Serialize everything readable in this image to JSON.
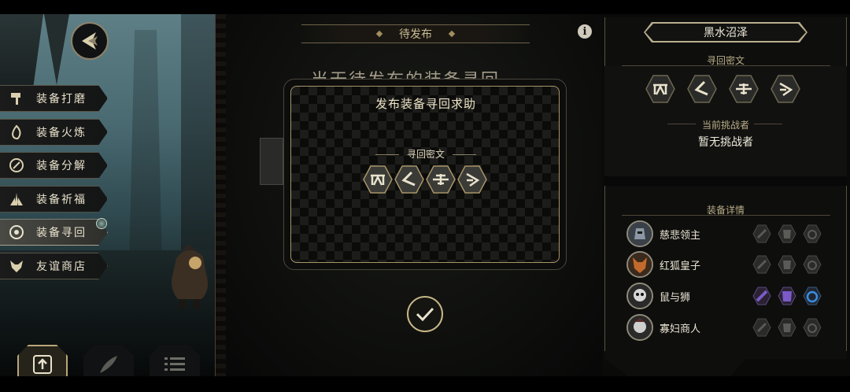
{
  "menu": {
    "items": [
      {
        "label": "装备打磨",
        "icon": "hammer-icon",
        "active": false
      },
      {
        "label": "装备火炼",
        "icon": "flame-icon",
        "active": false
      },
      {
        "label": "装备分解",
        "icon": "disassemble-icon",
        "active": false
      },
      {
        "label": "装备祈福",
        "icon": "blessing-icon",
        "active": false
      },
      {
        "label": "装备寻回",
        "icon": "retrieve-icon",
        "active": true
      },
      {
        "label": "友谊商店",
        "icon": "fox-icon",
        "active": false
      }
    ]
  },
  "middle": {
    "title": "待发布",
    "behind_text": "当无待发布的装备寻回"
  },
  "dialog": {
    "title": "发布装备寻回求助",
    "subtitle": "寻回密文"
  },
  "right_panel": {
    "title": "黑水沼泽",
    "cipher_label": "寻回密文",
    "challenger_label": "当前挑战者",
    "challenger_value": "暂无挑战者",
    "details_label": "装备详情",
    "heroes": [
      {
        "name": "慈悲领主",
        "equipped": false
      },
      {
        "name": "红狐皇子",
        "equipped": false
      },
      {
        "name": "鼠与狮",
        "equipped": true
      },
      {
        "name": "寡妇商人",
        "equipped": false
      }
    ]
  },
  "colors": {
    "gold": "#c7b888",
    "equipped_purple": "#6b4ab0",
    "equipped_blue": "#3a7fd0"
  }
}
